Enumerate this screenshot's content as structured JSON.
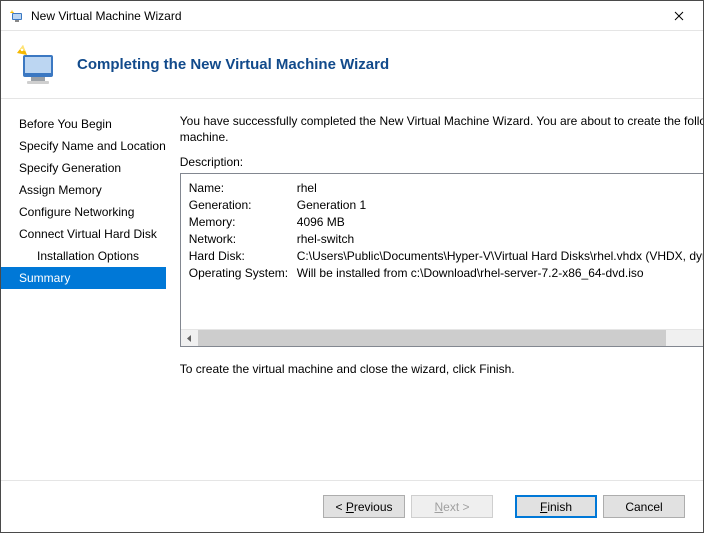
{
  "window": {
    "title": "New Virtual Machine Wizard"
  },
  "header": {
    "heading": "Completing the New Virtual Machine Wizard"
  },
  "sidebar": {
    "items": [
      {
        "label": "Before You Begin",
        "indent": false,
        "selected": false
      },
      {
        "label": "Specify Name and Location",
        "indent": false,
        "selected": false
      },
      {
        "label": "Specify Generation",
        "indent": false,
        "selected": false
      },
      {
        "label": "Assign Memory",
        "indent": false,
        "selected": false
      },
      {
        "label": "Configure Networking",
        "indent": false,
        "selected": false
      },
      {
        "label": "Connect Virtual Hard Disk",
        "indent": false,
        "selected": false
      },
      {
        "label": "Installation Options",
        "indent": true,
        "selected": false
      },
      {
        "label": "Summary",
        "indent": false,
        "selected": true
      }
    ]
  },
  "main": {
    "intro": "You have successfully completed the New Virtual Machine Wizard. You are about to create the following virtual machine.",
    "description_label": "Description:",
    "summary": [
      {
        "key": "Name:",
        "value": "rhel"
      },
      {
        "key": "Generation:",
        "value": "Generation 1"
      },
      {
        "key": "Memory:",
        "value": "4096 MB"
      },
      {
        "key": "Network:",
        "value": "rhel-switch"
      },
      {
        "key": "Hard Disk:",
        "value": "C:\\Users\\Public\\Documents\\Hyper-V\\Virtual Hard Disks\\rhel.vhdx (VHDX, dynamically expanding)"
      },
      {
        "key": "Operating System:",
        "value": "Will be installed from c:\\Download\\rhel-server-7.2-x86_64-dvd.iso"
      }
    ],
    "finish_note": "To create the virtual machine and close the wizard, click Finish."
  },
  "footer": {
    "previous_pre": "< ",
    "previous_u": "P",
    "previous_post": "revious",
    "next_u": "N",
    "next_post": "ext >",
    "finish_u": "F",
    "finish_post": "inish",
    "cancel": "Cancel"
  }
}
